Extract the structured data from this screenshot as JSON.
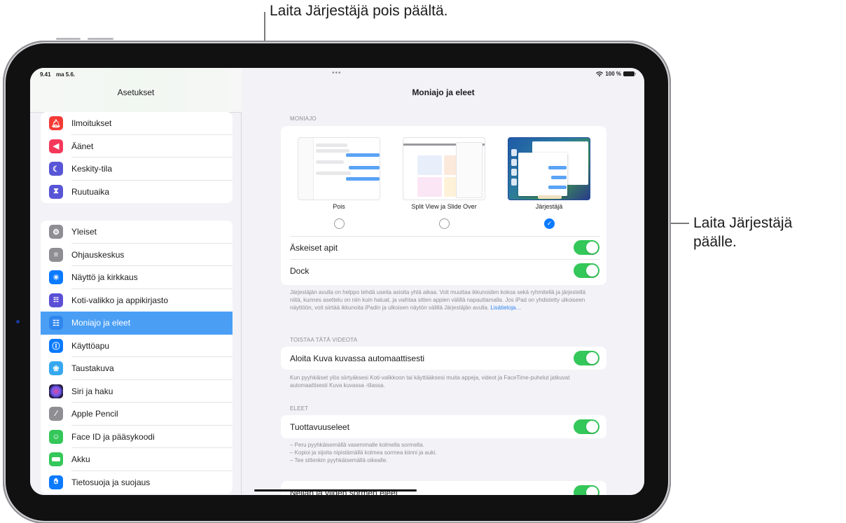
{
  "callouts": {
    "top": "Laita Järjestäjä pois päältä.",
    "right_line1": "Laita Järjestäjä",
    "right_line2": "päälle."
  },
  "status_bar": {
    "time": "9.41",
    "date": "ma 5.6.",
    "battery": "100 %",
    "multitask_dots": "•••"
  },
  "sidebar": {
    "title": "Asetukset",
    "groups": [
      {
        "items": [
          {
            "label": "Ilmoitukset",
            "icon": "bell-icon",
            "color": "#f53a35"
          },
          {
            "label": "Äänet",
            "icon": "speaker-icon",
            "color": "#f5385a"
          },
          {
            "label": "Keskity-tila",
            "icon": "moon-icon",
            "color": "#5856d6"
          },
          {
            "label": "Ruutuaika",
            "icon": "hourglass-icon",
            "color": "#5856d6"
          }
        ]
      },
      {
        "items": [
          {
            "label": "Yleiset",
            "icon": "gear-icon",
            "color": "#8e8e93"
          },
          {
            "label": "Ohjauskeskus",
            "icon": "switches-icon",
            "color": "#8e8e93"
          },
          {
            "label": "Näyttö ja kirkkaus",
            "icon": "sun-icon",
            "color": "#0a7aff"
          },
          {
            "label": "Koti-valikko ja appikirjasto",
            "icon": "app-grid-icon",
            "color": "#5b4fd6"
          },
          {
            "label": "Moniajo ja eleet",
            "icon": "multitasking-icon",
            "color": "#2f86ee",
            "active": true
          },
          {
            "label": "Käyttöapu",
            "icon": "accessibility-icon",
            "color": "#0a7aff"
          },
          {
            "label": "Taustakuva",
            "icon": "flower-icon",
            "color": "#36a8f0"
          },
          {
            "label": "Siri ja haku",
            "icon": "siri-icon",
            "color": "#2a1e3a"
          },
          {
            "label": "Apple Pencil",
            "icon": "pencil-icon",
            "color": "#8e8e93"
          },
          {
            "label": "Face ID ja pääsykoodi",
            "icon": "faceid-icon",
            "color": "#34c759"
          },
          {
            "label": "Akku",
            "icon": "battery-icon",
            "color": "#34c759"
          },
          {
            "label": "Tietosuoja ja suojaus",
            "icon": "hand-icon",
            "color": "#0a7aff"
          }
        ]
      }
    ]
  },
  "detail": {
    "title": "Moniajo ja eleet",
    "multitasking": {
      "header": "MONIAJO",
      "options": [
        {
          "label": "Pois",
          "selected": false
        },
        {
          "label": "Split View ja Slide Over",
          "selected": false
        },
        {
          "label": "Järjestäjä",
          "selected": true
        }
      ],
      "toggles": [
        {
          "label": "Äskeiset apit",
          "on": true
        },
        {
          "label": "Dock",
          "on": true
        }
      ],
      "footer": "Järjestäjän avulla on helppo tehdä useita asioita yhtä aikaa. Voit muuttaa ikkunoiden kokoa sekä ryhmitellä ja järjestellä niitä, kunnes asettelu on niin kuin haluat, ja vaihtaa sitten appien välillä napauttamalla. Jos iPad on yhdistetty ulkoiseen näyttöön, voit siirtää ikkunoita iPadin ja ulkoisen näytön välillä Järjestäjän avulla.",
      "footer_link": "Lisätietoja…"
    },
    "video": {
      "header": "TOISTAA TÄTÄ VIDEOTA",
      "toggle": {
        "label": "Aloita Kuva kuvassa automaattisesti",
        "on": true
      },
      "footer": "Kun pyyhkäiset ylös siirtyäksesi Koti-valikkoon tai käyttääksesi muita appeja, videot ja FaceTime-puhelut jatkuvat automaattisesti Kuva kuvassa -tilassa."
    },
    "gestures": {
      "header": "ELEET",
      "toggle": {
        "label": "Tuottavuuseleet",
        "on": true
      },
      "footer_lines": [
        "– Peru pyyhkäisemällä vasemmalle kolmella sormella.",
        "– Kopioi ja sijoita nipistämällä kolmea sormea kiinni ja auki.",
        "– Tee sittenkin pyyhkäisemällä oikealle."
      ],
      "partial_toggle": {
        "label": "Neljän ja viiden sormen eleet",
        "on": true
      }
    }
  }
}
